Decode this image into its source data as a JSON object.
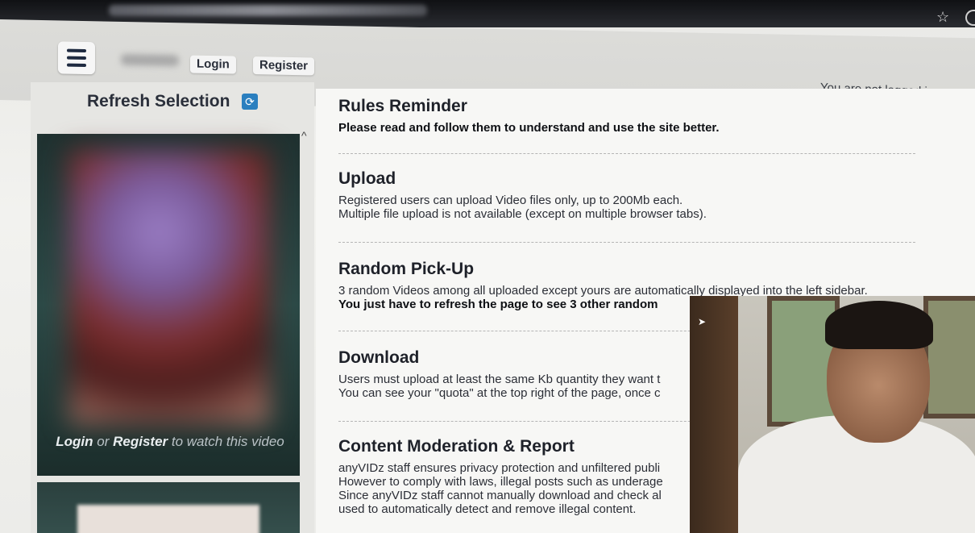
{
  "header": {
    "login_label": "Login",
    "register_label": "Register",
    "status_text": "You are not logged in."
  },
  "sidebar": {
    "title": "Refresh Selection",
    "refresh_icon": "refresh-icon",
    "video_cta": {
      "login": "Login",
      "or": "or",
      "register": "Register",
      "rest": "to watch this video"
    }
  },
  "main": {
    "sections": [
      {
        "title": "Rules Reminder",
        "bold": "Please read and follow them to understand and use the site better."
      },
      {
        "title": "Upload",
        "lines": [
          "Registered users can upload Video files only, up to 200Mb each.",
          "Multiple file upload is not available (except on multiple browser tabs)."
        ]
      },
      {
        "title": "Random Pick-Up",
        "lines": [
          "3 random Videos among all uploaded except yours are automatically displayed into the left sidebar."
        ],
        "bold": "You just have to refresh the page to see 3 other random"
      },
      {
        "title": "Download",
        "lines": [
          "Users must upload at least the same Kb quantity they want t",
          "You can see your \"quota\" at the top right of the page, once c"
        ]
      },
      {
        "title": "Content Moderation & Report",
        "lines": [
          "anyVIDz staff ensures privacy protection and unfiltered publi",
          "However to comply with laws, illegal posts such as underage",
          "Since anyVIDz staff cannot manually download and check al",
          "used to automatically detect and remove illegal content."
        ]
      }
    ]
  }
}
